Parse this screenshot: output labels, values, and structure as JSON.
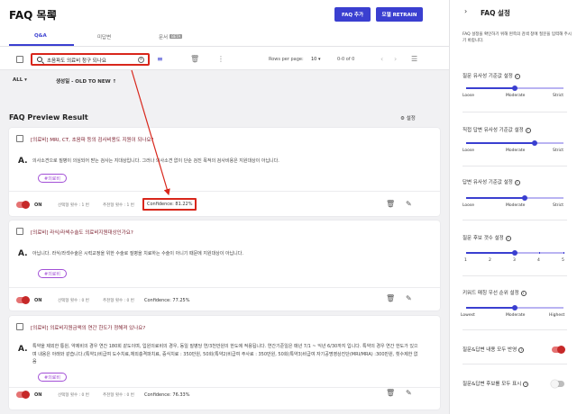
{
  "header": {
    "title": "FAQ 목록",
    "add_label": "FAQ 추가",
    "retrain_label": "모델 RETRAIN"
  },
  "tabs": [
    {
      "label": "Q&A"
    },
    {
      "label": "미답변"
    },
    {
      "label": "문서",
      "badge": "BETA"
    }
  ],
  "toolbar": {
    "search_value": "초음파도 의료비 청구 되나요",
    "clear_label": "×",
    "rows_per_page_label": "Rows per page:",
    "rows_per_page": "10 ▾",
    "range": "0-0 of 0"
  },
  "sort": {
    "filter": "ALL ▾",
    "order": "생성일 - OLD TO NEW ↑"
  },
  "preview": {
    "title": "FAQ Preview Result",
    "settings_label": "설정"
  },
  "cards": [
    {
      "question": "[의료비] MRI, CT, 초음파 등의 검사비용도 지원이 되나요?",
      "answer_mark": "A.",
      "answer": "의사소견으로 질병이 의심되어 받는 검사는 지대상입니다. 그러나 의사소견 없이 단순 검진 목적의 검사비용은 지원대상이 아닙니다.",
      "tag": "#의료비",
      "on_label": "ON",
      "selected": "선택형 횟수 : 1 번",
      "recommended": "추천형 횟수 : 1 번",
      "confidence": "Confidence: 81.22%"
    },
    {
      "question": "[의료비] 라식/라섹수술도 의료비지원대상인가요?",
      "answer_mark": "A.",
      "answer": "아닙니다. 라식/라섹수술은 시력교정을 위한 수술로 질병을 치료하는 수술이 아니기 때문에 지원대상이 아닙니다.",
      "tag": "#의료비",
      "on_label": "ON",
      "selected": "선택형 횟수 : 0 번",
      "recommended": "추천형 횟수 : 0 번",
      "confidence": "Confidence: 77.25%"
    },
    {
      "question": "[의료비] 의료비지원금액의 연간 한도가 정해져 있나요?",
      "answer_mark": "A.",
      "answer": "특약을 제외한 통원, 약제비의 경우 연간 180회 같도이며, 입원의료비의 경우, 동일 질병당 연/3천만원의 한도에 적용됩니다. 연간기준일은 매년 7/1 ~ 익년 6/30까지 입니다. 특약의 경우 연간 한도가 있으며 내용은 아래와 같습니다.(특약1)비급여 도수치료,체외충격파치료, 증식치료 : 350만원, 50회(특약2)비급여 주사료 : 350만원, 50회(특약3)비급여 자기공명영상진단(MRI/MRA) :300만원, 횟수제한 없음",
      "tag": "#의료비",
      "on_label": "ON",
      "selected": "선택형 횟수 : 0 번",
      "recommended": "추천형 횟수 : 0 번",
      "confidence": "Confidence: 76.33%"
    }
  ],
  "panel": {
    "title": "FAQ 설정",
    "description": "FAQ 설정을 확인하기 위해 왼쪽의 검색 창에 질문을 입력해 주시기 바랍니다.",
    "sliders": [
      {
        "label": "질문 유사성 기준값 설정",
        "min": "Loose",
        "mid": "Moderate",
        "max": "Strict",
        "value": 0.5
      },
      {
        "label": "직접 답변 유사성 기준값 설정",
        "min": "Loose",
        "mid": "Moderate",
        "max": "Strict",
        "value": 0.7
      },
      {
        "label": "답변 유사성 기준값 설정",
        "min": "Loose",
        "mid": "Moderate",
        "max": "Strict",
        "value": 0.6
      },
      {
        "label": "질문 후보 갯수 설정",
        "ticks": [
          "1",
          "2",
          "3",
          "4",
          "5"
        ],
        "value": 3
      },
      {
        "label": "키워드 매칭 우선 순위 설정",
        "min": "Lowest",
        "mid": "Moderate",
        "max": "Highest",
        "value": 0.5
      }
    ],
    "toggles": [
      {
        "label": "질문&답변 내용 모두 반영",
        "state": "on"
      },
      {
        "label": "질문&답변 후보를 모두 표시",
        "state": "off"
      }
    ]
  },
  "colors": {
    "accent": "#3a3fd0",
    "highlight": "#d8261b",
    "tag": "#a24fd6",
    "toggle_on": "#c62828",
    "question": "#7a1b2b"
  }
}
